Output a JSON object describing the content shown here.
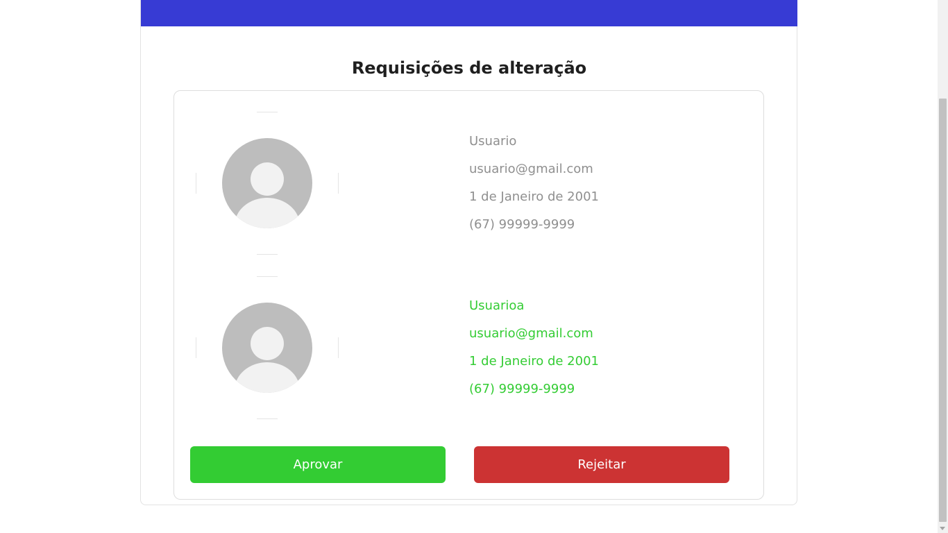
{
  "page": {
    "title": "Requisições de alteração"
  },
  "current_user": {
    "name": "Usuario",
    "email": "usuario@gmail.com",
    "birthdate": "1 de Janeiro de 2001",
    "phone": "(67) 99999-9999"
  },
  "requested_user": {
    "name": "Usuarioa",
    "email": "usuario@gmail.com",
    "birthdate": "1 de Janeiro de 2001",
    "phone": "(67) 99999-9999"
  },
  "actions": {
    "approve_label": "Aprovar",
    "reject_label": "Rejeitar"
  },
  "colors": {
    "header": "#373bd4",
    "approve": "#33cc33",
    "reject": "#cc3333",
    "current_text": "#8f8f8f",
    "requested_text": "#33cc33"
  },
  "icons": {
    "avatar": "user-avatar-placeholder-icon"
  }
}
